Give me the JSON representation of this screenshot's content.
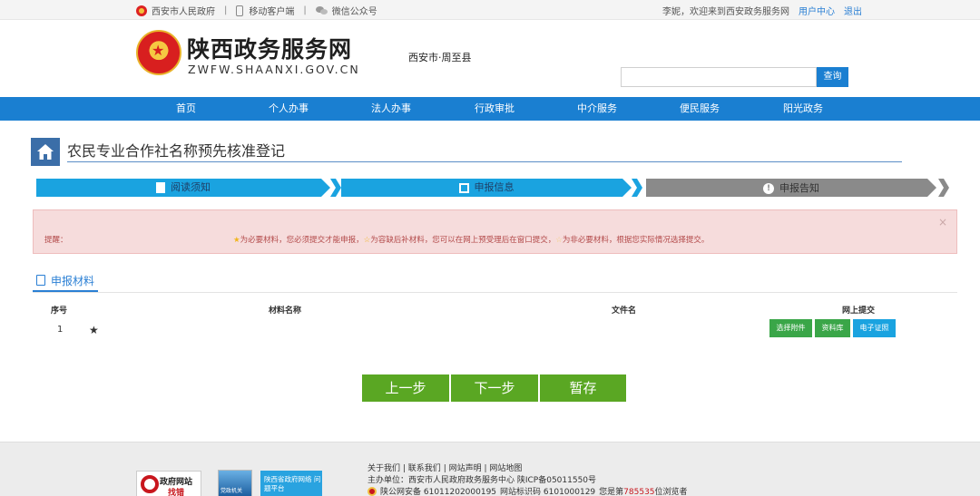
{
  "topbar": {
    "gov": "西安市人民政府",
    "mobile": "移动客户端",
    "wechat": "微信公众号",
    "welcome": "李妮，欢迎来到西安政务服务网",
    "user_center": "用户中心",
    "logout": "退出"
  },
  "header": {
    "logo_cn": "陕西政务服务网",
    "logo_en": "ZWFW.SHAANXI.GOV.CN",
    "region": "西安市·周至县",
    "search_placeholder": "",
    "search_button": "查询"
  },
  "nav": [
    "首页",
    "个人办事",
    "法人办事",
    "行政审批",
    "中介服务",
    "便民服务",
    "阳光政务"
  ],
  "page": {
    "title": "农民专业合作社名称预先核准登记"
  },
  "steps": [
    {
      "label": "阅读须知",
      "state": "done",
      "color": "#1aa3e0"
    },
    {
      "label": "申报信息",
      "state": "current",
      "color": "#1aa3e0"
    },
    {
      "label": "申报告知",
      "state": "pending",
      "color": "#8a8a8a"
    }
  ],
  "alert": {
    "label": "提醒：",
    "part1": "为必要材料，您必须提交才能申报，",
    "part2": "为容缺后补材料，您可以在网上预受理后在窗口提交，",
    "part3": "为非必要材料，根据您实际情况选择提交。",
    "close": "×"
  },
  "materials_tab": "申报材料",
  "table": {
    "headers": [
      "序号",
      "材料名称",
      "文件名",
      "网上提交"
    ],
    "rows": [
      {
        "index": "1",
        "name": "",
        "filename": "",
        "buttons": [
          "选择附件",
          "资料库",
          "电子证照"
        ]
      }
    ]
  },
  "actions": [
    "上一步",
    "下一步",
    "暂存"
  ],
  "footer": {
    "links": [
      "关于我们",
      "联系我们",
      "网站声明",
      "网站地图"
    ],
    "sponsor": "主办单位：西安市人民政府政务服务中心   陕ICP备05011550号",
    "police": "陕公网安备 61011202000195",
    "site_code": "网站标识码 6101000129",
    "visitor_prefix": "您是第",
    "visitor_count": "785535",
    "visitor_suffix": "位浏览者",
    "badge1_line1": "政府网站",
    "badge1_line2": "找错",
    "badge2": "党政机关",
    "badge3": "陕西省政府网络\n问题平台"
  },
  "colors": {
    "primary": "#1a7fd1",
    "step_active": "#1aa3e0",
    "step_pending": "#8a8a8a",
    "action_green": "#5aa723",
    "alert_bg": "#f6dcdc",
    "visitor_red": "#c8161d"
  }
}
